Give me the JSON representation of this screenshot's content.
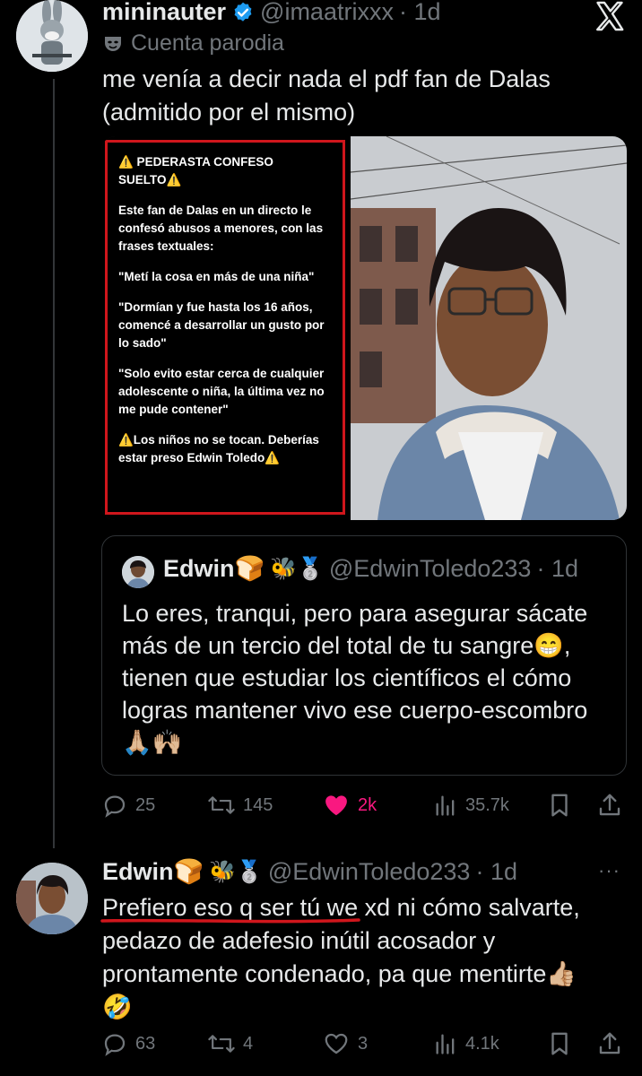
{
  "post": {
    "display_name": "mininauter",
    "handle": "@imaatrixxx",
    "time": "· 1d",
    "label": "Cuenta parodia",
    "text": "me venía a decir nada el pdf fan de Dalas (admitido por el mismo)",
    "image_text": {
      "headline": "⚠️ PEDERASTA CONFESO SUELTO⚠️",
      "p1": "Este fan de Dalas en un directo le confesó abusos a menores, con las frases textuales:",
      "p2": "\"Metí la cosa en más de una niña\"",
      "p3": "\"Dormían y fue hasta los 16 años, comencé a desarrollar un gusto por lo sado\"",
      "p4": "\"Solo evito estar cerca de cualquier adolescente o niña, la última vez no me pude contener\"",
      "p5": "⚠️Los niños no se tocan. Deberías estar preso Edwin Toledo⚠️"
    },
    "stats": {
      "replies": "25",
      "reposts": "145",
      "likes": "2k",
      "views": "35.7k"
    },
    "colors": {
      "like": "#f91880",
      "verified": "#1d9bf0",
      "frame": "#d0161c"
    }
  },
  "quote": {
    "display_name": "Edwin🍞",
    "badges": "🐝🥈",
    "handle": "@EdwinToledo233",
    "time": "· 1d",
    "text": "Lo eres, tranqui, pero para asegurar sácate más de un tercio del total de tu sangre😁, tienen que estudiar los científicos el cómo logras mantener vivo ese cuerpo-escombro 🙏🏼🙌🏼"
  },
  "reply": {
    "display_name": "Edwin🍞",
    "badges": "🐝🥈",
    "handle": "@EdwinToledo233",
    "time": "· 1d",
    "more": "···",
    "text": "Prefiero eso q ser tú we xd ni cómo salvarte, pedazo de adefesio inútil acosador y prontamente condenado, pa que mentirte👍🏼 🤣",
    "stats": {
      "replies": "63",
      "reposts": "4",
      "likes": "3",
      "views": "4.1k"
    }
  }
}
